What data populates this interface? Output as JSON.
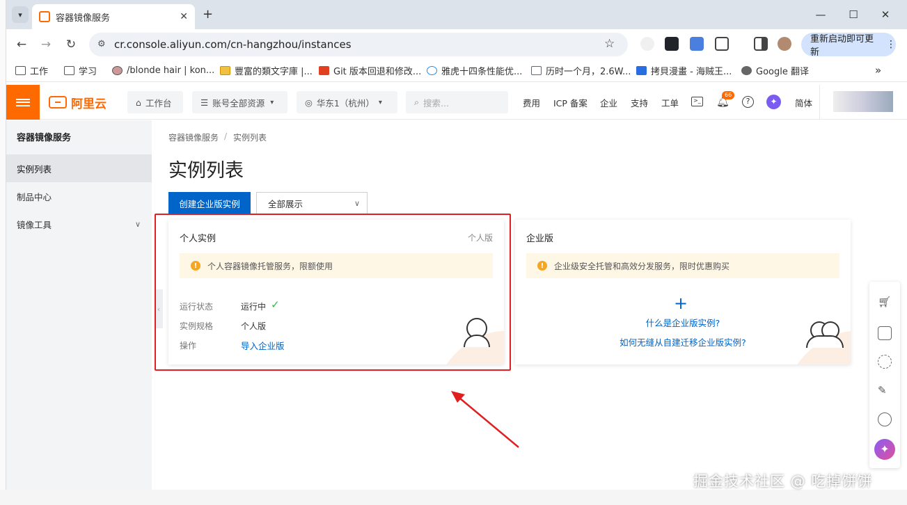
{
  "browser": {
    "tab_title": "容器镜像服务",
    "url": "cr.console.aliyun.com/cn-hangzhou/instances",
    "restart_label": "重新启动即可更新",
    "bookmarks": [
      "工作",
      "学习",
      "/blonde hair | kon...",
      "豐富的類文字庫 |...",
      "Git 版本回退和修改...",
      "雅虎十四条性能优...",
      "历时一个月，2.6W...",
      "拷貝漫畫 - 海贼王...",
      "Google 翻译"
    ]
  },
  "console": {
    "logo_text": "阿里云",
    "workbench": "工作台",
    "resources": "账号全部资源",
    "region": "华东1（杭州）",
    "search_placeholder": "搜索...",
    "nav": [
      "费用",
      "ICP 备案",
      "企业",
      "支持",
      "工单"
    ],
    "notification_count": "66",
    "lang": "简体"
  },
  "sidebar": {
    "title": "容器镜像服务",
    "items": [
      "实例列表",
      "制品中心",
      "镜像工具"
    ]
  },
  "main": {
    "breadcrumb_root": "容器镜像服务",
    "breadcrumb_sep": "/",
    "breadcrumb_current": "实例列表",
    "title": "实例列表",
    "create_button": "创建企业版实例",
    "filter_value": "全部展示",
    "personal_card": {
      "title": "个人实例",
      "tag": "个人版",
      "notice": "个人容器镜像托管服务，限额使用",
      "status_label": "运行状态",
      "status_value": "运行中",
      "spec_label": "实例规格",
      "spec_value": "个人版",
      "action_label": "操作",
      "action_link": "导入企业版"
    },
    "enterprise_card": {
      "title": "企业版",
      "notice": "企业级安全托管和高效分发服务，限时优惠购买",
      "link1": "什么是企业版实例?",
      "link2": "如何无缝从自建迁移企业版实例?"
    }
  },
  "watermark": "掘金技术社区 @ 吃掉饼饼"
}
